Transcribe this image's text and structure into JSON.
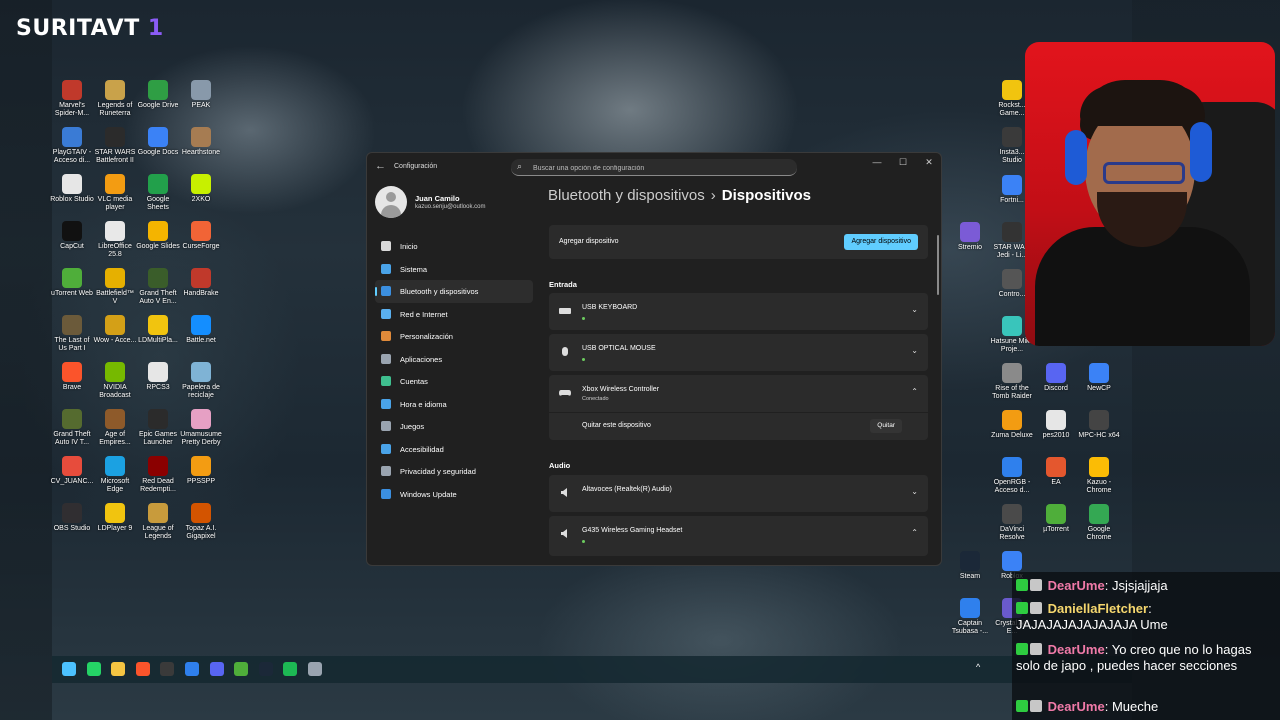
{
  "overlay": {
    "brand": "SURITAVT",
    "brand_accent": "1"
  },
  "desktop_left": [
    {
      "label": "Marvel's Spider-M...",
      "color": "#c0392b"
    },
    {
      "label": "Legends of Runeterra",
      "color": "#c9a24a"
    },
    {
      "label": "Google Drive",
      "color": "#2f9e44"
    },
    {
      "label": "PEAK",
      "color": "#8899aa"
    },
    {
      "label": "PlayGTAIV - Acceso di...",
      "color": "#3a7bd5"
    },
    {
      "label": "STAR WARS Battlefront II",
      "color": "#2b2b2b"
    },
    {
      "label": "Google Docs",
      "color": "#3b82f6"
    },
    {
      "label": "Hearthstone",
      "color": "#a67c52"
    },
    {
      "label": "Roblox Studio",
      "color": "#e6e6e6"
    },
    {
      "label": "VLC media player",
      "color": "#f39c12"
    },
    {
      "label": "Google Sheets",
      "color": "#22a04b"
    },
    {
      "label": "2XKO",
      "color": "#c7f000"
    },
    {
      "label": "CapCut",
      "color": "#111111"
    },
    {
      "label": "LibreOffice 25.8",
      "color": "#e8e8e8"
    },
    {
      "label": "Google Slides",
      "color": "#f4b400"
    },
    {
      "label": "CurseForge",
      "color": "#f16436"
    },
    {
      "label": "uTorrent Web",
      "color": "#4fae3a"
    },
    {
      "label": "Battlefield™ V",
      "color": "#e6b000"
    },
    {
      "label": "Grand Theft Auto V En...",
      "color": "#3a5d2a"
    },
    {
      "label": "HandBrake",
      "color": "#c0392b"
    },
    {
      "label": "The Last of Us Part I",
      "color": "#6b5a3a"
    },
    {
      "label": "Wow - Acce...",
      "color": "#d4a017"
    },
    {
      "label": "LDMultiPla...",
      "color": "#f1c40f"
    },
    {
      "label": "Battle.net",
      "color": "#148eff"
    },
    {
      "label": "Brave",
      "color": "#fb542b"
    },
    {
      "label": "NVIDIA Broadcast",
      "color": "#76b900"
    },
    {
      "label": "RPCS3",
      "color": "#e6e6e6"
    },
    {
      "label": "Papelera de reciclaje",
      "color": "#7fb3d5"
    },
    {
      "label": "Grand Theft Auto IV T...",
      "color": "#556b2f"
    },
    {
      "label": "Age of Empires...",
      "color": "#8e5a2a"
    },
    {
      "label": "Epic Games Launcher",
      "color": "#2b2b2b"
    },
    {
      "label": "Umamusume Pretty Derby",
      "color": "#e6a0c4"
    },
    {
      "label": "CV_JUANC...",
      "color": "#e74c3c"
    },
    {
      "label": "Microsoft Edge",
      "color": "#1ba1e2"
    },
    {
      "label": "Red Dead Redempti...",
      "color": "#8b0000"
    },
    {
      "label": "PPSSPP",
      "color": "#f39c12"
    },
    {
      "label": "OBS Studio",
      "color": "#302e31"
    },
    {
      "label": "LDPlayer 9",
      "color": "#f1c40f"
    },
    {
      "label": "League of Legends",
      "color": "#c89b3c"
    },
    {
      "label": "Topaz A.I. Gigapixel",
      "color": "#d35400"
    }
  ],
  "desktop_right": [
    {
      "label": "Rockst... Game...",
      "color": "#f1c40f"
    },
    {
      "label": "Insta3... Studio",
      "color": "#3a3a3a"
    },
    {
      "label": "Fortni...",
      "color": "#3b82f6"
    },
    {
      "label": "Stremio",
      "color": "#7b5bd6"
    },
    {
      "label": "STAR WA... Jedi - Li...",
      "color": "#333333"
    },
    {
      "label": "Contro...",
      "color": "#555555"
    },
    {
      "label": "Hatsune Miku Proje...",
      "color": "#39c5bb"
    },
    {
      "label": "Rise of the Tomb Raider",
      "color": "#8a8a8a"
    },
    {
      "label": "Discord",
      "color": "#5865f2"
    },
    {
      "label": "NewCP",
      "color": "#3b82f6"
    },
    {
      "label": "Zuma Deluxe",
      "color": "#f39c12"
    },
    {
      "label": "pes2010",
      "color": "#e6e6e6"
    },
    {
      "label": "MPC-HC x64",
      "color": "#444444"
    },
    {
      "label": "OpenRGB - Acceso d...",
      "color": "#2f80ed"
    },
    {
      "label": "EA",
      "color": "#e4572e"
    },
    {
      "label": "Kazuo - Chrome",
      "color": "#fbbc05"
    },
    {
      "label": "DaVinci Resolve",
      "color": "#4a4a4a"
    },
    {
      "label": "µTorrent",
      "color": "#4fae3a"
    },
    {
      "label": "Google Chrome",
      "color": "#34a853"
    },
    {
      "label": "Steam",
      "color": "#1b2838"
    },
    {
      "label": "Roblox",
      "color": "#3b82f6"
    },
    {
      "label": "Captain Tsubasa -...",
      "color": "#2f80ed"
    },
    {
      "label": "Crystal Aoi E...",
      "color": "#6a5acd"
    }
  ],
  "settings": {
    "app_title": "Configuración",
    "search_placeholder": "Buscar una opción de configuración",
    "user": {
      "name": "Juan Camilo",
      "email": "kazuo.senju@outlook.com"
    },
    "nav": [
      {
        "label": "Inicio",
        "icon": "home-icon",
        "color": "#d9d9d9",
        "selected": false
      },
      {
        "label": "Sistema",
        "icon": "system-icon",
        "color": "#4aa3e8",
        "selected": false
      },
      {
        "label": "Bluetooth y dispositivos",
        "icon": "bluetooth-icon",
        "color": "#3b8fe0",
        "selected": true
      },
      {
        "label": "Red e Internet",
        "icon": "wifi-icon",
        "color": "#5ab0f0",
        "selected": false
      },
      {
        "label": "Personalización",
        "icon": "brush-icon",
        "color": "#e08a3a",
        "selected": false
      },
      {
        "label": "Aplicaciones",
        "icon": "apps-icon",
        "color": "#9aa4b0",
        "selected": false
      },
      {
        "label": "Cuentas",
        "icon": "accounts-icon",
        "color": "#3fbf8f",
        "selected": false
      },
      {
        "label": "Hora e idioma",
        "icon": "globe-clock-icon",
        "color": "#4aa3e8",
        "selected": false
      },
      {
        "label": "Juegos",
        "icon": "gamepad-icon",
        "color": "#9aa4b0",
        "selected": false
      },
      {
        "label": "Accesibilidad",
        "icon": "accessibility-icon",
        "color": "#4aa3e8",
        "selected": false
      },
      {
        "label": "Privacidad y seguridad",
        "icon": "shield-icon",
        "color": "#9aa4b0",
        "selected": false
      },
      {
        "label": "Windows Update",
        "icon": "update-icon",
        "color": "#3b8fe0",
        "selected": false
      }
    ],
    "breadcrumb": {
      "parent": "Bluetooth y dispositivos",
      "separator": "›",
      "current": "Dispositivos"
    },
    "add_device": {
      "label": "Agregar dispositivo",
      "button": "Agregar dispositivo"
    },
    "sections": {
      "input": "Entrada",
      "audio": "Audio"
    },
    "input_devices": [
      {
        "name": "USB KEYBOARD",
        "status": "",
        "icon": "keyboard-icon",
        "expanded": false
      },
      {
        "name": "USB OPTICAL MOUSE",
        "status": "",
        "icon": "mouse-icon",
        "expanded": false
      },
      {
        "name": "Xbox Wireless Controller",
        "status": "Conectado",
        "icon": "gamepad-icon",
        "expanded": true
      }
    ],
    "remove_row": {
      "label": "Quitar este dispositivo",
      "button": "Quitar"
    },
    "audio_devices": [
      {
        "name": "Altavoces (Realtek(R) Audio)",
        "icon": "speaker-icon",
        "expanded": false
      },
      {
        "name": "G435 Wireless Gaming Headset",
        "icon": "speaker-icon",
        "expanded": true
      }
    ],
    "accent": "#60cdff"
  },
  "taskbar": {
    "items": [
      {
        "name": "start-icon",
        "color": "#4cc2ff"
      },
      {
        "name": "whatsapp-icon",
        "color": "#25d366"
      },
      {
        "name": "file-explorer-icon",
        "color": "#f5c542"
      },
      {
        "name": "brave-icon",
        "color": "#fb542b"
      },
      {
        "name": "obs-icon",
        "color": "#3a3a3a"
      },
      {
        "name": "ccleaner-icon",
        "color": "#2f80ed"
      },
      {
        "name": "discord-icon",
        "color": "#5865f2"
      },
      {
        "name": "utorrent-icon",
        "color": "#4fae3a"
      },
      {
        "name": "steam-icon",
        "color": "#1b2838"
      },
      {
        "name": "spotify-icon",
        "color": "#1db954"
      },
      {
        "name": "settings-icon",
        "color": "#9aa4b0"
      }
    ],
    "tray_chevron": "^"
  },
  "chat": [
    {
      "user": "DearUme",
      "text": "Jsjsjajjaja",
      "user_color": "#f07aa8"
    },
    {
      "user": "DaniellaFletcher",
      "text": "JAJAJAJAJAJAJAJA Ume",
      "user_color": "#f5d76e"
    },
    {
      "user": "DearUme",
      "text": "Yo creo que no lo hagas solo de japo , puedes hacer secciones",
      "user_color": "#f07aa8"
    },
    {
      "user": "DearUme",
      "text": "Mueche",
      "user_color": "#f07aa8"
    }
  ]
}
